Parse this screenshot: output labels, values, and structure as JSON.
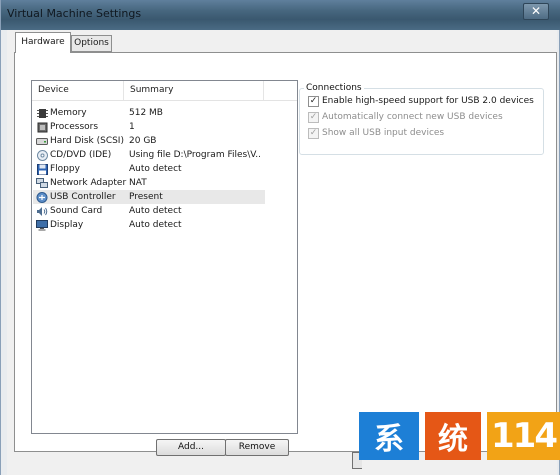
{
  "window": {
    "title": "Virtual Machine Settings",
    "close_glyph": "✕"
  },
  "tabs": [
    {
      "label": "Hardware",
      "active": true
    },
    {
      "label": "Options",
      "active": false
    }
  ],
  "device_list": {
    "headers": {
      "device": "Device",
      "summary": "Summary"
    },
    "rows": [
      {
        "name": "Memory",
        "summary": "512 MB",
        "icon": "memory-icon"
      },
      {
        "name": "Processors",
        "summary": "1",
        "icon": "processor-icon"
      },
      {
        "name": "Hard Disk (SCSI)",
        "summary": "20 GB",
        "icon": "hard-disk-icon"
      },
      {
        "name": "CD/DVD (IDE)",
        "summary": "Using file D:\\Program Files\\V...",
        "icon": "cd-dvd-icon"
      },
      {
        "name": "Floppy",
        "summary": "Auto detect",
        "icon": "floppy-icon"
      },
      {
        "name": "Network Adapter",
        "summary": "NAT",
        "icon": "network-adapter-icon"
      },
      {
        "name": "USB Controller",
        "summary": "Present",
        "icon": "usb-controller-icon",
        "selected": true
      },
      {
        "name": "Sound Card",
        "summary": "Auto detect",
        "icon": "sound-card-icon"
      },
      {
        "name": "Display",
        "summary": "Auto detect",
        "icon": "display-icon"
      }
    ]
  },
  "buttons": {
    "add": "Add...",
    "remove": "Remove"
  },
  "connections": {
    "legend": "Connections",
    "options": [
      {
        "label": "Enable high-speed support for USB 2.0 devices",
        "checked": true,
        "enabled": true
      },
      {
        "label": "Automatically connect new USB devices",
        "checked": true,
        "enabled": false
      },
      {
        "label": "Show all USB input devices",
        "checked": true,
        "enabled": false
      }
    ]
  },
  "watermark": {
    "char1": "系",
    "char2": "统",
    "number": "114"
  },
  "colors": {
    "selection": "#e8e8e8",
    "title_bar": "#47677f",
    "watermark_blue": "#1d7fd6",
    "watermark_orange": "#e55716",
    "watermark_yellow": "#f2a316"
  }
}
